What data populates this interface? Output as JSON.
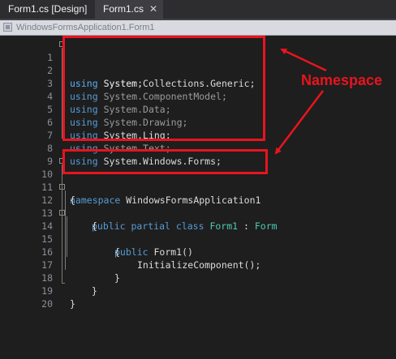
{
  "tabs": [
    {
      "label": "Form1.cs [Design]"
    },
    {
      "label": "Form1.cs",
      "close": "✕"
    }
  ],
  "nav": {
    "path": "WindowsFormsApplication1.Form1"
  },
  "editor": {
    "line_numbers": [
      "1",
      "2",
      "3",
      "4",
      "5",
      "6",
      "7",
      "8",
      "9",
      "10",
      "11",
      "12",
      "13",
      "14",
      "15",
      "16",
      "17",
      "18",
      "19",
      "20"
    ],
    "usings": [
      {
        "kw": "using",
        "ns": "System;"
      },
      {
        "kw": "using",
        "ns": "System.Collections.Generic;"
      },
      {
        "kw": "using",
        "ns": "System.ComponentModel;"
      },
      {
        "kw": "using",
        "ns": "System.Data;"
      },
      {
        "kw": "using",
        "ns": "System.Drawing;"
      },
      {
        "kw": "using",
        "ns": "System.Linq;"
      },
      {
        "kw": "using",
        "ns": "System.Text;"
      },
      {
        "kw": "using",
        "ns": "System.Windows.Forms;"
      }
    ],
    "namespace_kw": "namespace",
    "namespace_name": "WindowsFormsApplication1",
    "open_brace": "{",
    "close_brace": "}",
    "class_line": {
      "kw1": "public",
      "kw2": "partial",
      "kw3": "class",
      "name": "Form1",
      "colon": " : ",
      "base": "Form"
    },
    "ctor_line": {
      "kw": "public",
      "name": "Form1()"
    },
    "call": "InitializeComponent();"
  },
  "annotation": {
    "label": "Namespace",
    "color": "#e8141e"
  }
}
